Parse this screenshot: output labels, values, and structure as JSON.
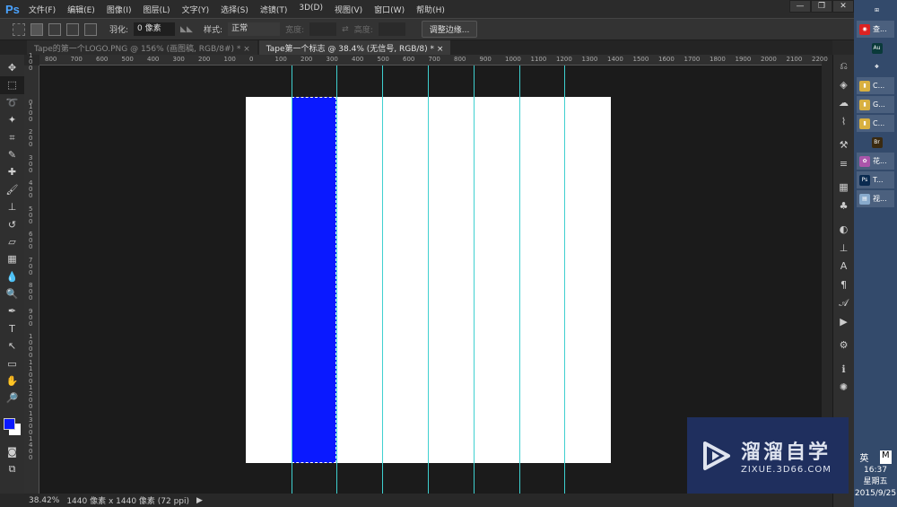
{
  "app": {
    "logo": "Ps"
  },
  "menu": [
    "文件(F)",
    "编辑(E)",
    "图像(I)",
    "图层(L)",
    "文字(Y)",
    "选择(S)",
    "滤镜(T)",
    "3D(D)",
    "视图(V)",
    "窗口(W)",
    "帮助(H)"
  ],
  "window_controls": [
    "—",
    "❐",
    "✕"
  ],
  "options": {
    "feather_label": "羽化:",
    "feather_value": "0 像素",
    "style_label": "样式:",
    "style_value": "正常",
    "width_label": "宽度:",
    "height_label": "高度:",
    "refine_edge": "调整边缘..."
  },
  "tabs": [
    {
      "label": "Tape的第一个LOGO.PNG @ 156% (画图稿, RGB/8#) *",
      "close": "×"
    },
    {
      "label": "Tape第一个标志 @ 38.4% (无信号, RGB/8) *",
      "close": "×"
    }
  ],
  "ruler_h": [
    "800",
    "700",
    "600",
    "500",
    "400",
    "300",
    "200",
    "100",
    "0",
    "100",
    "200",
    "300",
    "400",
    "500",
    "600",
    "700",
    "800",
    "900",
    "1000",
    "1100",
    "1200",
    "1300",
    "1400",
    "1500",
    "1600",
    "1700",
    "1800",
    "1900",
    "2000",
    "2100",
    "2200"
  ],
  "ruler_v": [
    "100",
    "0",
    "100",
    "200",
    "300",
    "400",
    "500",
    "600",
    "700",
    "800",
    "900",
    "1000",
    "1100",
    "1200",
    "1300",
    "1400"
  ],
  "tools": [
    "move-icon",
    "marquee-icon",
    "lasso-icon",
    "magic-wand-icon",
    "crop-icon",
    "eyedropper-icon",
    "healing-icon",
    "brush-icon",
    "stamp-icon",
    "history-brush-icon",
    "eraser-icon",
    "gradient-icon",
    "blur-icon",
    "dodge-icon",
    "pen-icon",
    "type-icon",
    "path-select-icon",
    "rectangle-icon",
    "hand-icon",
    "zoom-icon"
  ],
  "tool_glyphs": [
    "✥",
    "⬚",
    "➰",
    "✦",
    "⌗",
    "✎",
    "✚",
    "🖌",
    "⊥",
    "↺",
    "▱",
    "▦",
    "💧",
    "🔍",
    "✒",
    "T",
    "↖",
    "▭",
    "✋",
    "🔎"
  ],
  "colors": {
    "foreground": "#0a19ff",
    "background": "#ffffff",
    "guide": "#3fd0d0"
  },
  "status": {
    "zoom": "38.42%",
    "info": "1440 像素 x 1440 像素 (72 ppi)",
    "arrow": "▶"
  },
  "right_panel_icons": [
    "history-icon",
    "layers-icon",
    "channels-icon",
    "paths-icon",
    "tool-presets-icon",
    "brush-settings-icon",
    "swatches-icon",
    "styles-icon",
    "adjustments-icon",
    "clone-source-icon",
    "character-icon",
    "paragraph-icon",
    "glyph-icon",
    "actions-icon",
    "properties-icon",
    "info-icon",
    "navigator-icon"
  ],
  "right_panel_glyphs": [
    "⎌",
    "◈",
    "☁",
    "⌇",
    "⚒",
    "≡",
    "▦",
    "♣",
    "◐",
    "⊥",
    "A",
    "¶",
    "𝒜",
    "▶",
    "⚙",
    "ℹ",
    "✺"
  ],
  "taskbar": {
    "items": [
      {
        "icon": "⊞",
        "label": ""
      },
      {
        "icon": "◉",
        "label": "查..."
      },
      {
        "icon": "Au",
        "label": ""
      },
      {
        "icon": "❖",
        "label": ""
      },
      {
        "icon": "▮",
        "label": "C..."
      },
      {
        "icon": "▮",
        "label": "G..."
      },
      {
        "icon": "▮",
        "label": "C..."
      },
      {
        "icon": "Br",
        "label": ""
      },
      {
        "icon": "✿",
        "label": "花..."
      },
      {
        "icon": "Ps",
        "label": "T..."
      },
      {
        "icon": "▤",
        "label": "视..."
      }
    ],
    "lang": "英",
    "ime": "M",
    "time": "16:37",
    "weekday": "星期五",
    "date": "2015/9/25"
  },
  "watermark": {
    "title": "溜溜自学",
    "url": "ZIXUE.3D66.COM"
  }
}
